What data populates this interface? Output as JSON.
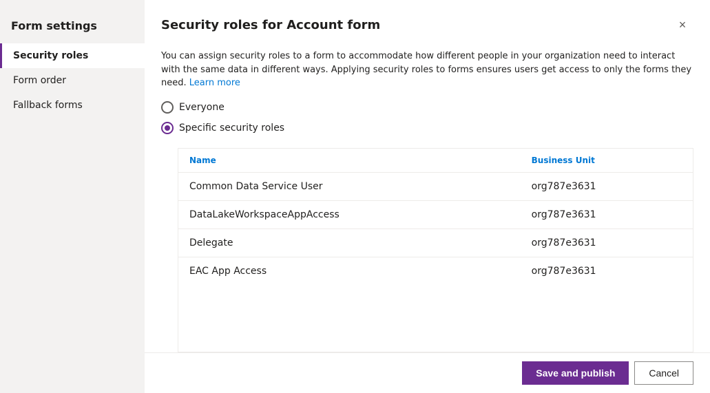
{
  "sidebar": {
    "title": "Form settings",
    "items": [
      {
        "id": "security-roles",
        "label": "Security roles",
        "active": true
      },
      {
        "id": "form-order",
        "label": "Form order",
        "active": false
      },
      {
        "id": "fallback-forms",
        "label": "Fallback forms",
        "active": false
      }
    ]
  },
  "dialog": {
    "title": "Security roles for Account form",
    "close_label": "×",
    "description_part1": "You can assign security roles to a form to accommodate how different people in your organization need to interact with the same data in different ways. Applying security roles to forms ensures users get access to only the forms they need.",
    "learn_more_label": "Learn more",
    "learn_more_url": "#"
  },
  "radio_options": [
    {
      "id": "everyone",
      "label": "Everyone",
      "selected": false
    },
    {
      "id": "specific",
      "label": "Specific security roles",
      "selected": true
    }
  ],
  "table": {
    "columns": [
      {
        "id": "name",
        "label": "Name"
      },
      {
        "id": "business_unit",
        "label": "Business Unit"
      }
    ],
    "rows": [
      {
        "name": "Common Data Service User",
        "business_unit": "org787e3631"
      },
      {
        "name": "DataLakeWorkspaceAppAccess",
        "business_unit": "org787e3631"
      },
      {
        "name": "Delegate",
        "business_unit": "org787e3631"
      },
      {
        "name": "EAC App Access",
        "business_unit": "org787e3631"
      }
    ]
  },
  "footer": {
    "save_publish_label": "Save and publish",
    "cancel_label": "Cancel"
  },
  "colors": {
    "accent": "#6b2c91",
    "link": "#0078d4"
  }
}
